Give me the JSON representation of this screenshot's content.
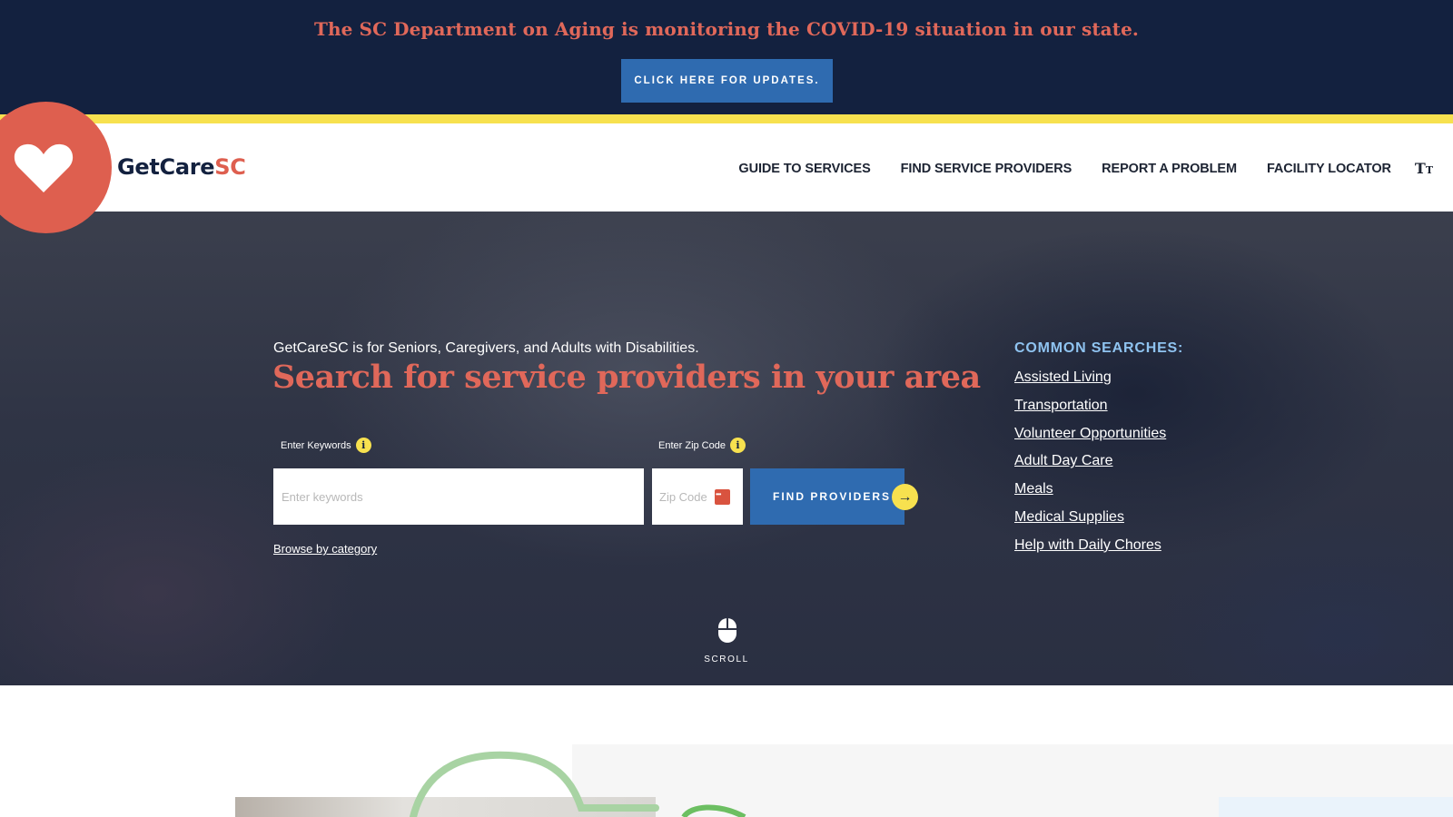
{
  "alert": {
    "message": "The SC Department on Aging is monitoring the COVID-19 situation in our state.",
    "button_label": "CLICK HERE FOR UPDATES."
  },
  "header": {
    "logo_text_main": "GetCare",
    "logo_text_accent": "SC",
    "logo_icon": "heart-icon",
    "nav": [
      {
        "label": "GUIDE TO SERVICES"
      },
      {
        "label": "FIND SERVICE PROVIDERS"
      },
      {
        "label": "REPORT A PROBLEM"
      },
      {
        "label": "FACILITY LOCATOR"
      }
    ],
    "text_size_icon": "text-size-icon"
  },
  "hero": {
    "tagline": "GetCareSC is for Seniors, Caregivers, and Adults with Disabilities.",
    "title": "Search for service providers in your area",
    "keywords_label": "Enter Keywords",
    "keywords_placeholder": "Enter keywords",
    "zip_label": "Enter Zip Code",
    "zip_placeholder": "Zip Code",
    "find_button_label": "FIND PROVIDERS",
    "browse_link": "Browse by category",
    "scroll_label": "SCROLL"
  },
  "common_searches": {
    "heading": "COMMON SEARCHES:",
    "items": [
      "Assisted Living",
      "Transportation",
      "Volunteer Opportunities",
      "Adult Day Care",
      "Meals",
      "Medical Supplies",
      "Help with Daily Chores"
    ]
  },
  "colors": {
    "navy": "#13213f",
    "coral": "#de5f4f",
    "button_blue": "#2f6bb0",
    "yellow": "#f7e14f",
    "light_blue_heading": "#8fc3f0",
    "deco_green": "#8fc98a"
  }
}
